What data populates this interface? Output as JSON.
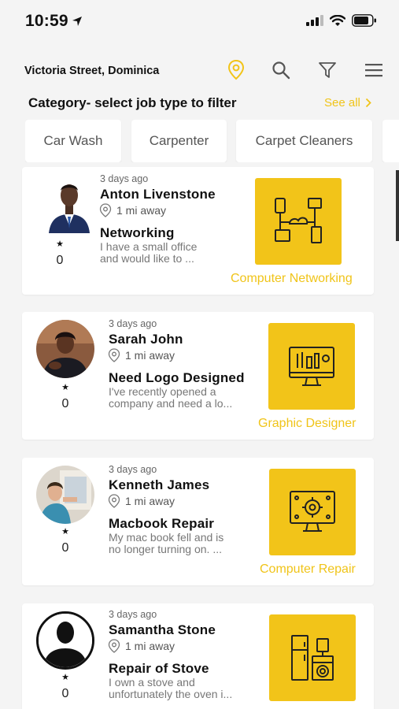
{
  "status_bar": {
    "time": "10:59"
  },
  "header": {
    "location": "Victoria Street, Dominica",
    "icons": [
      "location-pin-icon",
      "search-icon",
      "filter-icon",
      "menu-icon"
    ]
  },
  "category_section": {
    "title": "Category- select job type to filter",
    "see_all": "See all"
  },
  "chips": [
    "Car Wash",
    "Carpenter",
    "Carpet Cleaners"
  ],
  "jobs": [
    {
      "posted": "3 days ago",
      "name": "Anton Livenstone",
      "distance": "1 mi away",
      "rating_count": "0",
      "title": "Networking",
      "description_line1": "I have a small office",
      "description_line2": "and would like to ...",
      "category": "Computer Networking",
      "category_icon": "network-icon"
    },
    {
      "posted": "3 days ago",
      "name": "Sarah John",
      "distance": "1 mi away",
      "rating_count": "0",
      "title": "Need Logo Designed",
      "description_line1": "I've recently opened a",
      "description_line2": "company and need a lo...",
      "category": "Graphic Designer",
      "category_icon": "graphic-design-icon"
    },
    {
      "posted": "3 days ago",
      "name": "Kenneth James",
      "distance": "1 mi away",
      "rating_count": "0",
      "title": "Macbook Repair",
      "description_line1": "My mac book fell and is",
      "description_line2": "no longer turning on. ...",
      "category": "Computer Repair",
      "category_icon": "computer-repair-icon"
    },
    {
      "posted": "3 days ago",
      "name": "Samantha Stone",
      "distance": "1 mi away",
      "rating_count": "0",
      "title": "Repair of Stove",
      "description_line1": "I own a stove and",
      "description_line2": "unfortunately the oven i...",
      "category": "",
      "category_icon": "appliance-icon"
    }
  ],
  "colors": {
    "accent": "#f2c419",
    "background": "#f4f4f4",
    "card": "#ffffff"
  }
}
